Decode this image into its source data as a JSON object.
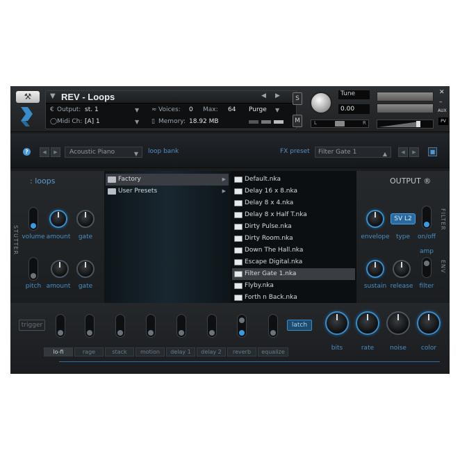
{
  "header": {
    "wrench_icon": "wrench-icon",
    "instrument_title": "REV - Loops",
    "output_label": "Output:",
    "output_value": "st. 1",
    "voices_label": "Voices:",
    "voices_value": "0",
    "max_label": "Max:",
    "max_value": "64",
    "purge_label": "Purge",
    "midi_label": "Midi Ch:",
    "midi_value": "[A]  1",
    "memory_label": "Memory:",
    "memory_value": "18.92 MB",
    "s_label": "S",
    "m_label": "M",
    "tune_label": "Tune",
    "tune_value": "0.00",
    "pan_l": "L",
    "pan_r": "R",
    "aux_label": "AUX",
    "pv_label": "PV"
  },
  "toolbar": {
    "help": "?",
    "preset_value": "Acoustic Piano",
    "loop_bank": "loop bank",
    "fx_preset_label": "FX preset",
    "fx_preset_value": "Filter Gate 1"
  },
  "left": {
    "title": ": loops",
    "side_label": "STUTTER",
    "knobs": [
      "volume",
      "amount",
      "gate",
      "pitch",
      "amount",
      "gate"
    ]
  },
  "right": {
    "title": "OUTPUT ®",
    "filter_side": "FILTER",
    "env_side": "ENV",
    "type_value": "SV L2",
    "labels": [
      "envelope",
      "type",
      "on/off",
      "sustain",
      "release",
      "filter"
    ],
    "amp_label": "amp"
  },
  "browser": {
    "folders": [
      "Factory",
      "User Presets"
    ],
    "files": [
      "Default.nka",
      "Delay 16 x 8.nka",
      "Delay 8 x 4.nka",
      "Delay 8 x Half T.nka",
      "Dirty Pulse.nka",
      "Dirty Room.nka",
      "Down The Hall.nka",
      "Escape Digital.nka",
      "Filter Gate 1.nka",
      "Flyby.nka",
      "Forth n Back.nka"
    ],
    "selected_file": "Filter Gate 1.nka"
  },
  "bottom": {
    "trigger": "trigger",
    "latch": "latch",
    "tabs": [
      "lo-fi",
      "rage",
      "stack",
      "motion",
      "delay 1",
      "delay 2",
      "reverb",
      "equalize"
    ],
    "active_tab": "lo-fi",
    "knobs": [
      "bits",
      "rate",
      "noise",
      "color"
    ]
  },
  "colors": {
    "accent": "#3a8cc8",
    "bg": "#1a1c1e",
    "label_blue": "#4a8fc4"
  }
}
